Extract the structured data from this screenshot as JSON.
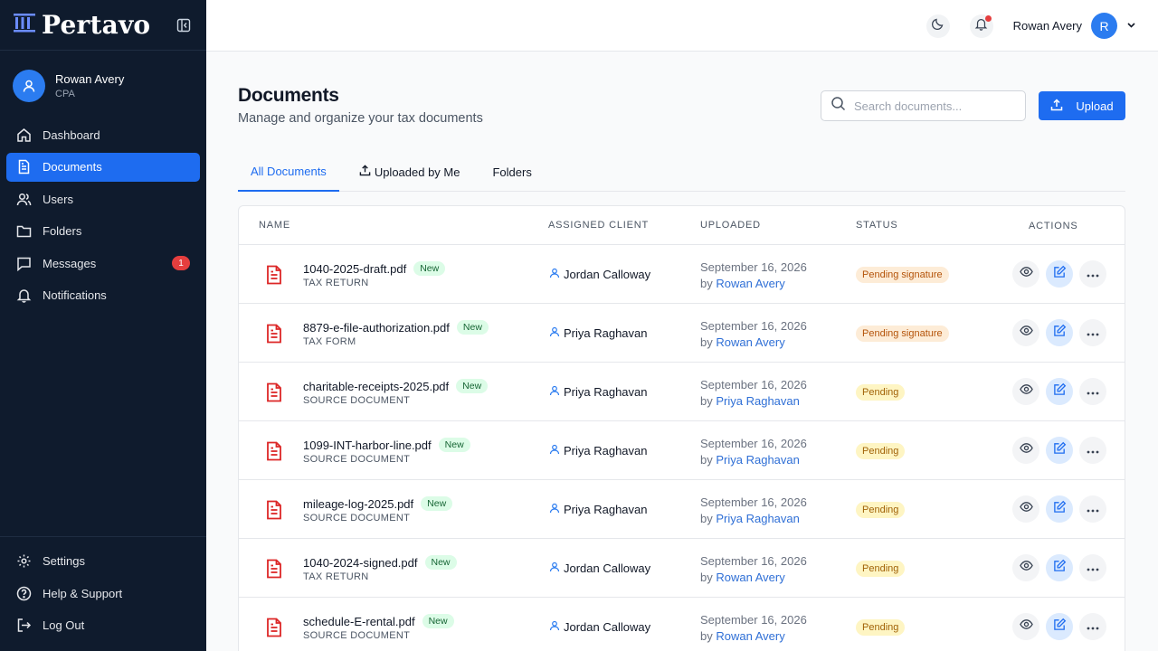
{
  "brand": {
    "name": "Pertavo"
  },
  "sidebar": {
    "profile": {
      "name": "Rowan Avery",
      "role": "CPA"
    },
    "items": [
      {
        "label": "Dashboard",
        "icon": "home-icon"
      },
      {
        "label": "Documents",
        "icon": "document-icon",
        "active": true
      },
      {
        "label": "Users",
        "icon": "users-icon"
      },
      {
        "label": "Folders",
        "icon": "folder-icon"
      },
      {
        "label": "Messages",
        "icon": "message-icon",
        "badge": "1"
      },
      {
        "label": "Notifications",
        "icon": "bell-icon"
      }
    ],
    "bottom_items": [
      {
        "label": "Settings",
        "icon": "gear-icon"
      },
      {
        "label": "Help & Support",
        "icon": "help-icon"
      },
      {
        "label": "Log Out",
        "icon": "logout-icon"
      }
    ]
  },
  "topbar": {
    "user_name": "Rowan Avery",
    "avatar_initial": "R"
  },
  "page": {
    "title": "Documents",
    "subtitle": "Manage and organize your tax documents",
    "search_placeholder": "Search documents...",
    "upload_label": "Upload"
  },
  "tabs": [
    {
      "label": "All Documents",
      "active": true
    },
    {
      "label": "Uploaded by Me"
    },
    {
      "label": "Folders"
    }
  ],
  "table": {
    "columns": [
      "NAME",
      "ASSIGNED CLIENT",
      "UPLOADED",
      "STATUS",
      "ACTIONS"
    ],
    "rows": [
      {
        "name": "1040-2025-draft.pdf",
        "badge": "New",
        "type": "TAX RETURN",
        "client": "Jordan Calloway",
        "date": "September 16, 2026",
        "by_prefix": "by",
        "by": "Rowan Avery",
        "status": "Pending signature"
      },
      {
        "name": "8879-e-file-authorization.pdf",
        "badge": "New",
        "type": "TAX FORM",
        "client": "Priya Raghavan",
        "date": "September 16, 2026",
        "by_prefix": "by",
        "by": "Rowan Avery",
        "status": "Pending signature"
      },
      {
        "name": "charitable-receipts-2025.pdf",
        "badge": "New",
        "type": "SOURCE DOCUMENT",
        "client": "Priya Raghavan",
        "date": "September 16, 2026",
        "by_prefix": "by",
        "by": "Priya Raghavan",
        "status": "Pending"
      },
      {
        "name": "1099-INT-harbor-line.pdf",
        "badge": "New",
        "type": "SOURCE DOCUMENT",
        "client": "Priya Raghavan",
        "date": "September 16, 2026",
        "by_prefix": "by",
        "by": "Priya Raghavan",
        "status": "Pending"
      },
      {
        "name": "mileage-log-2025.pdf",
        "badge": "New",
        "type": "SOURCE DOCUMENT",
        "client": "Priya Raghavan",
        "date": "September 16, 2026",
        "by_prefix": "by",
        "by": "Priya Raghavan",
        "status": "Pending"
      },
      {
        "name": "1040-2024-signed.pdf",
        "badge": "New",
        "type": "TAX RETURN",
        "client": "Jordan Calloway",
        "date": "September 16, 2026",
        "by_prefix": "by",
        "by": "Rowan Avery",
        "status": "Pending"
      },
      {
        "name": "schedule-E-rental.pdf",
        "badge": "New",
        "type": "SOURCE DOCUMENT",
        "client": "Jordan Calloway",
        "date": "September 16, 2026",
        "by_prefix": "by",
        "by": "Rowan Avery",
        "status": "Pending"
      }
    ]
  },
  "colors": {
    "sidebar_bg": "#0f1b2d",
    "accent": "#1e6cf0",
    "danger": "#e53e3e",
    "file_icon": "#dc2626"
  }
}
